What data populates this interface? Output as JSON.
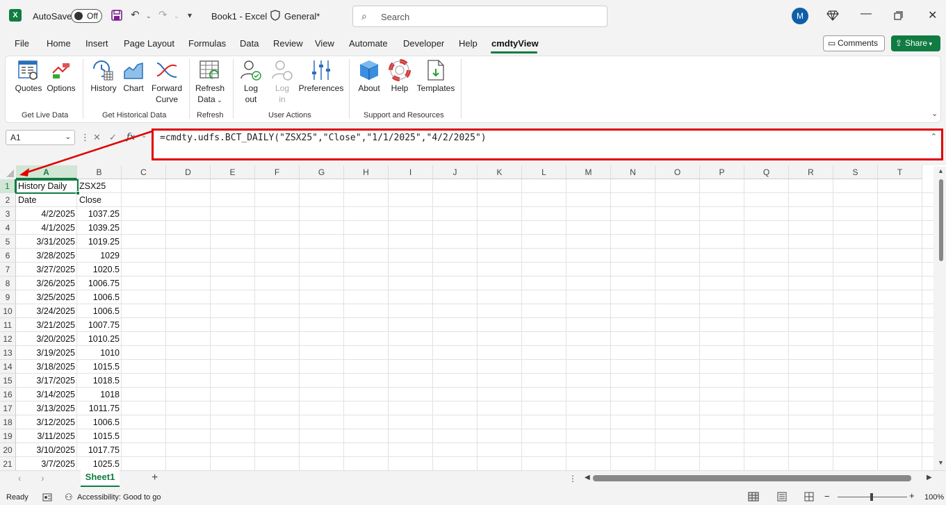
{
  "titlebar": {
    "autosave_label": "AutoSave",
    "autosave_state": "Off",
    "doc_title": "Book1  -  Excel",
    "sensitivity": "General*",
    "search_placeholder": "Search",
    "user_initial": "M"
  },
  "menu": [
    "File",
    "Home",
    "Insert",
    "Page Layout",
    "Formulas",
    "Data",
    "Review",
    "View",
    "Automate",
    "Developer",
    "Help",
    "cmdtyView"
  ],
  "menu_active": "cmdtyView",
  "comments_label": "Comments",
  "share_label": "Share",
  "ribbon": {
    "buttons": {
      "quotes": "Quotes",
      "options": "Options",
      "history": "History",
      "chart": "Chart",
      "forward": "Forward",
      "forward2": "Curve",
      "refresh": "Refresh",
      "refresh2": "Data",
      "logout": "Log",
      "logout2": "out",
      "login": "Log",
      "login2": "in",
      "preferences": "Preferences",
      "about": "About",
      "help": "Help",
      "templates": "Templates"
    },
    "groups": {
      "live": "Get Live Data",
      "historical": "Get Historical Data",
      "refresh": "Refresh",
      "user": "User Actions",
      "support": "Support and Resources"
    }
  },
  "namebox": "A1",
  "formula": "=cmdty.udfs.BCT_DAILY(\"ZSX25\",\"Close\",\"1/1/2025\",\"4/2/2025\")",
  "columns": [
    "A",
    "B",
    "C",
    "D",
    "E",
    "F",
    "G",
    "H",
    "I",
    "J",
    "K",
    "L",
    "M",
    "N",
    "O",
    "P",
    "Q",
    "R",
    "S",
    "T"
  ],
  "rows": [
    "1",
    "2",
    "3",
    "4",
    "5",
    "6",
    "7",
    "8",
    "9",
    "10",
    "11",
    "12",
    "13",
    "14",
    "15",
    "16",
    "17",
    "18",
    "19",
    "20",
    "21"
  ],
  "cells": {
    "a1": "History Daily",
    "b1": "ZSX25",
    "a2": "Date",
    "b2": "Close",
    "data": [
      [
        "4/2/2025",
        "1037.25"
      ],
      [
        "4/1/2025",
        "1039.25"
      ],
      [
        "3/31/2025",
        "1019.25"
      ],
      [
        "3/28/2025",
        "1029"
      ],
      [
        "3/27/2025",
        "1020.5"
      ],
      [
        "3/26/2025",
        "1006.75"
      ],
      [
        "3/25/2025",
        "1006.5"
      ],
      [
        "3/24/2025",
        "1006.5"
      ],
      [
        "3/21/2025",
        "1007.75"
      ],
      [
        "3/20/2025",
        "1010.25"
      ],
      [
        "3/19/2025",
        "1010"
      ],
      [
        "3/18/2025",
        "1015.5"
      ],
      [
        "3/17/2025",
        "1018.5"
      ],
      [
        "3/14/2025",
        "1018"
      ],
      [
        "3/13/2025",
        "1011.75"
      ],
      [
        "3/12/2025",
        "1006.5"
      ],
      [
        "3/11/2025",
        "1015.5"
      ],
      [
        "3/10/2025",
        "1017.75"
      ],
      [
        "3/7/2025",
        "1025.5"
      ]
    ]
  },
  "sheet_tab": "Sheet1",
  "status": {
    "ready": "Ready",
    "accessibility": "Accessibility: Good to go",
    "zoom": "100%"
  },
  "colors": {
    "excel_green": "#107c41",
    "annotation_red": "#e00000"
  }
}
